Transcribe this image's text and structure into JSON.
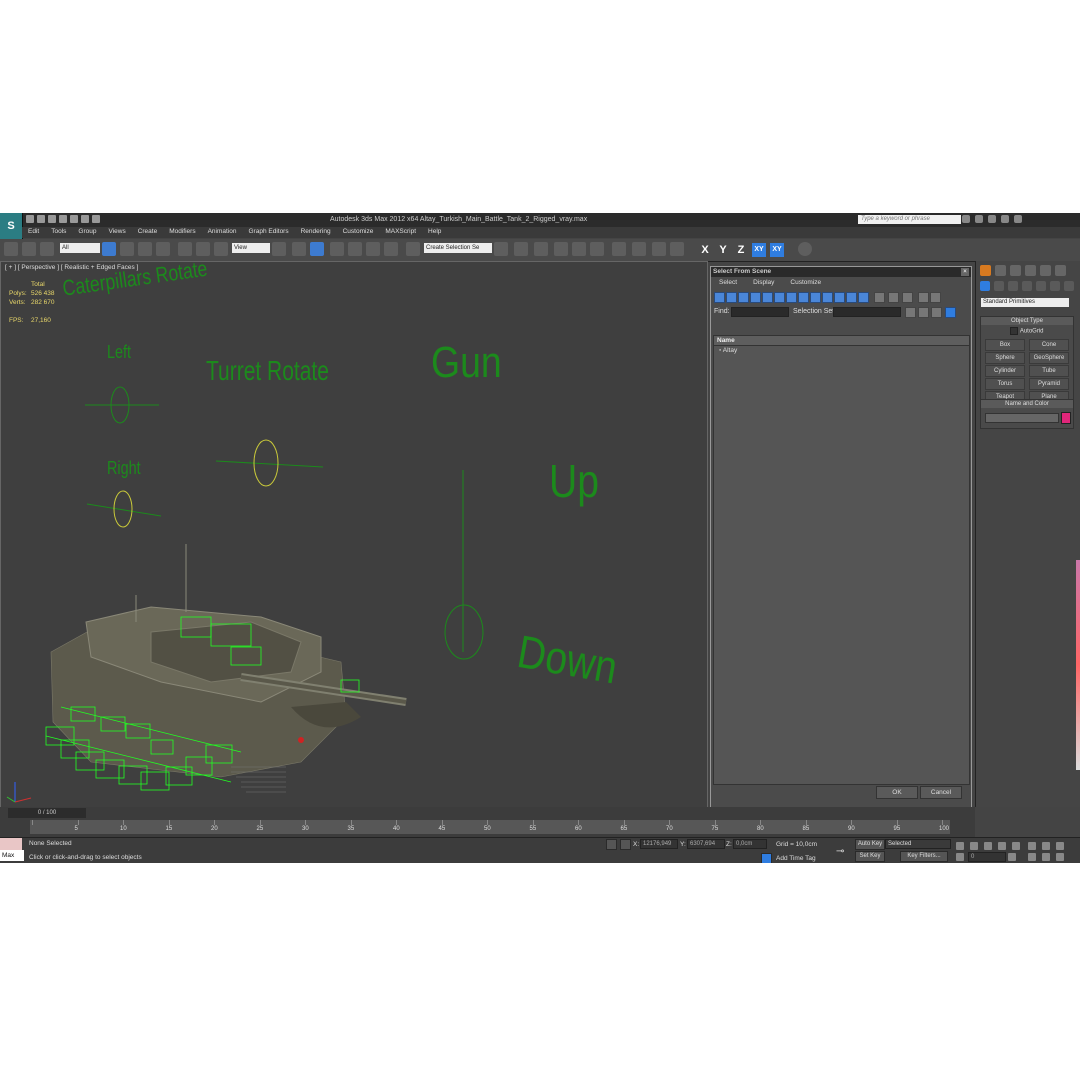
{
  "app": {
    "title": "Autodesk 3ds Max  2012 x64     Altay_Turkish_Main_Battle_Tank_2_Rigged_vray.max",
    "search_placeholder": "Type a keyword or phrase",
    "logo_text": "S"
  },
  "menu": [
    "Edit",
    "Tools",
    "Group",
    "Views",
    "Create",
    "Modifiers",
    "Animation",
    "Graph Editors",
    "Rendering",
    "Customize",
    "MAXScript",
    "Help"
  ],
  "toolbar": {
    "selection_filter": "All",
    "reference_coord": "View",
    "named_selection": "Create Selection Se",
    "axes": [
      "X",
      "Y",
      "Z",
      "XY",
      "XY"
    ]
  },
  "viewport": {
    "label": "[ + ] [ Perspective ] [ Realistic + Edged Faces ]",
    "stats": {
      "total_label": "Total",
      "polys_label": "Polys:",
      "polys_value": "526 438",
      "verts_label": "Verts:",
      "verts_value": "282 670",
      "fps_label": "FPS:",
      "fps_value": "27,160"
    },
    "controls": {
      "caterpillars": "Caterpillars Rotate",
      "left": "Left",
      "right": "Right",
      "turret": "Turret Rotate",
      "gun": "Gun",
      "up": "Up",
      "down": "Down"
    }
  },
  "select_dialog": {
    "title": "Select From Scene",
    "menu": [
      "Select",
      "Display",
      "Customize"
    ],
    "find_label": "Find:",
    "selection_set_label": "Selection Set:",
    "column_name": "Name",
    "items": [
      "Altay"
    ],
    "ok": "OK",
    "cancel": "Cancel"
  },
  "command_panel": {
    "category": "Standard Primitives",
    "object_type_header": "Object Type",
    "autogrid": "AutoGrid",
    "objects": [
      "Box",
      "Cone",
      "Sphere",
      "GeoSphere",
      "Cylinder",
      "Tube",
      "Torus",
      "Pyramid",
      "Teapot",
      "Plane"
    ],
    "name_color_header": "Name and Color",
    "object_color": "#e0267a"
  },
  "timeline": {
    "slider": "0 / 100",
    "ticks": [
      "0",
      "5",
      "10",
      "15",
      "20",
      "25",
      "30",
      "35",
      "40",
      "45",
      "50",
      "55",
      "60",
      "65",
      "70",
      "75",
      "80",
      "85",
      "90",
      "95",
      "100"
    ]
  },
  "status": {
    "maxscript": "Max",
    "selection": "None Selected",
    "prompt": "Click or click-and-drag to select objects",
    "x_label": "X:",
    "x_value": "12176,949",
    "y_label": "Y:",
    "y_value": "6307,694",
    "z_label": "Z:",
    "z_value": "0,0cm",
    "grid": "Grid = 10,0cm",
    "add_time_tag": "Add Time Tag",
    "auto_key": "Auto Key",
    "set_key": "Set Key",
    "key_mode": "Selected",
    "key_filters": "Key Filters...",
    "frame": "0"
  },
  "colors": {
    "control_green": "#1c8a1c",
    "wire_green": "#22ff22",
    "stats_yellow": "#e8d76a",
    "accent_blue": "#3d7bd0"
  }
}
